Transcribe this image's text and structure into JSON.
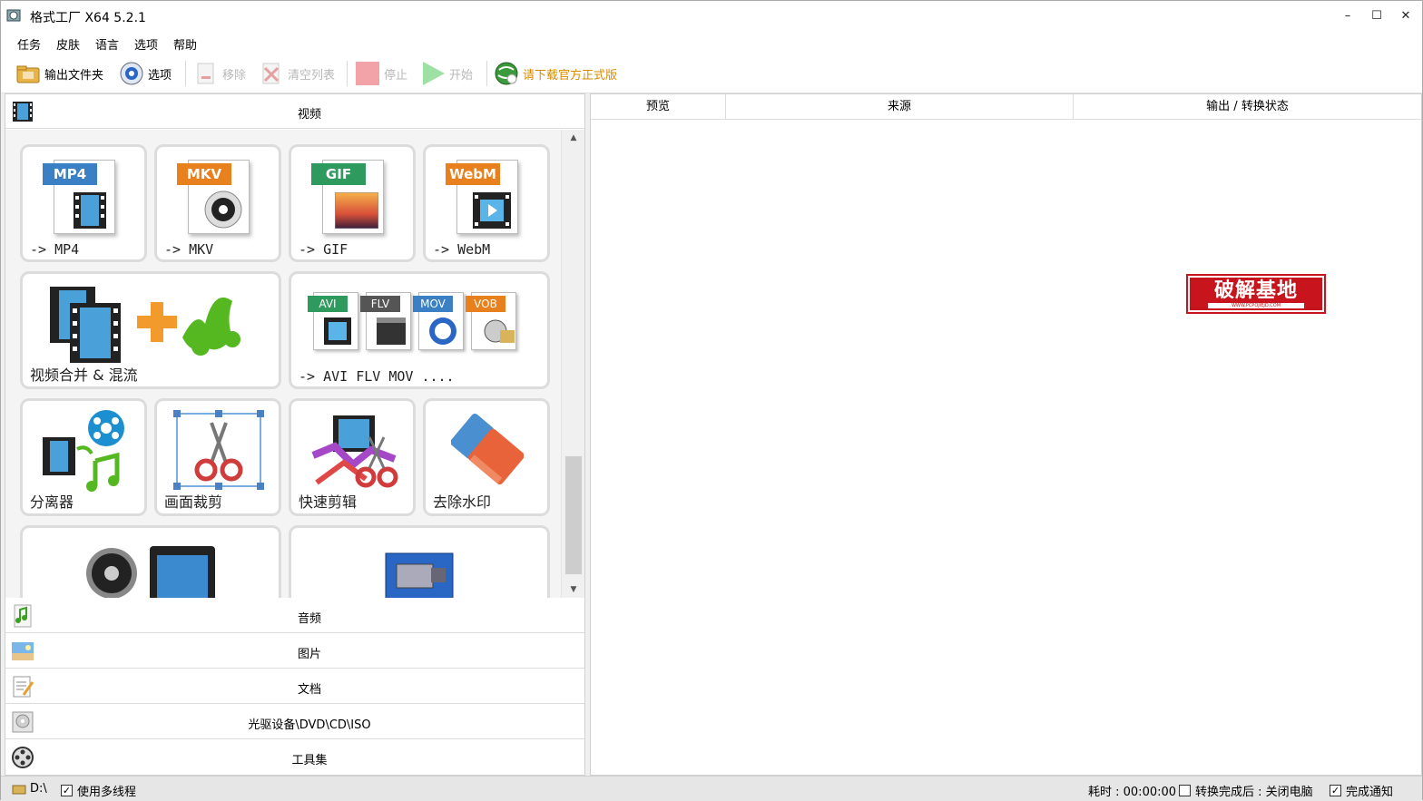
{
  "window": {
    "title": "格式工厂 X64 5.2.1",
    "minimize": "–",
    "maximize": "☐",
    "close": "✕"
  },
  "menu": [
    "任务",
    "皮肤",
    "语言",
    "选项",
    "帮助"
  ],
  "toolbar": {
    "output_folder": "输出文件夹",
    "options": "选项",
    "remove": "移除",
    "clear_list": "清空列表",
    "stop": "停止",
    "start": "开始",
    "download": "请下载官方正式版"
  },
  "categories": {
    "video": "视频",
    "audio": "音频",
    "image": "图片",
    "document": "文档",
    "disc": "光驱设备\\DVD\\CD\\ISO",
    "tools": "工具集"
  },
  "tiles": {
    "mp4": {
      "tag": "MP4",
      "label": "-> MP4"
    },
    "mkv": {
      "tag": "MKV",
      "label": "-> MKV"
    },
    "gif": {
      "tag": "GIF",
      "label": "-> GIF"
    },
    "webm": {
      "tag": "WebM",
      "label": "-> WebM"
    },
    "merge": {
      "label": "视频合并 & 混流"
    },
    "multi": {
      "tags": [
        "AVI",
        "FLV",
        "MOV",
        "VOB"
      ],
      "label": "-> AVI FLV MOV ...."
    },
    "splitter": {
      "label": "分离器"
    },
    "crop": {
      "label": "画面裁剪"
    },
    "quickcut": {
      "label": "快速剪辑"
    },
    "watermark": {
      "label": "去除水印"
    }
  },
  "table": {
    "columns": [
      "预览",
      "来源",
      "输出 / 转换状态"
    ]
  },
  "logo": {
    "text": "破解基地",
    "sub": "WWW.PCPOJIEJD.COM"
  },
  "status": {
    "drive": "D:\\",
    "multithread": "使用多线程",
    "elapsed": "耗时 : 00:00:00",
    "after_convert": "转换完成后 : 关闭电脑",
    "notify": "完成通知"
  },
  "colors": {
    "mp4": "#3b7fc4",
    "mkv": "#e8801e",
    "gif": "#2e9a5e",
    "webm": "#e8801e",
    "logo_red": "#c8141c"
  }
}
